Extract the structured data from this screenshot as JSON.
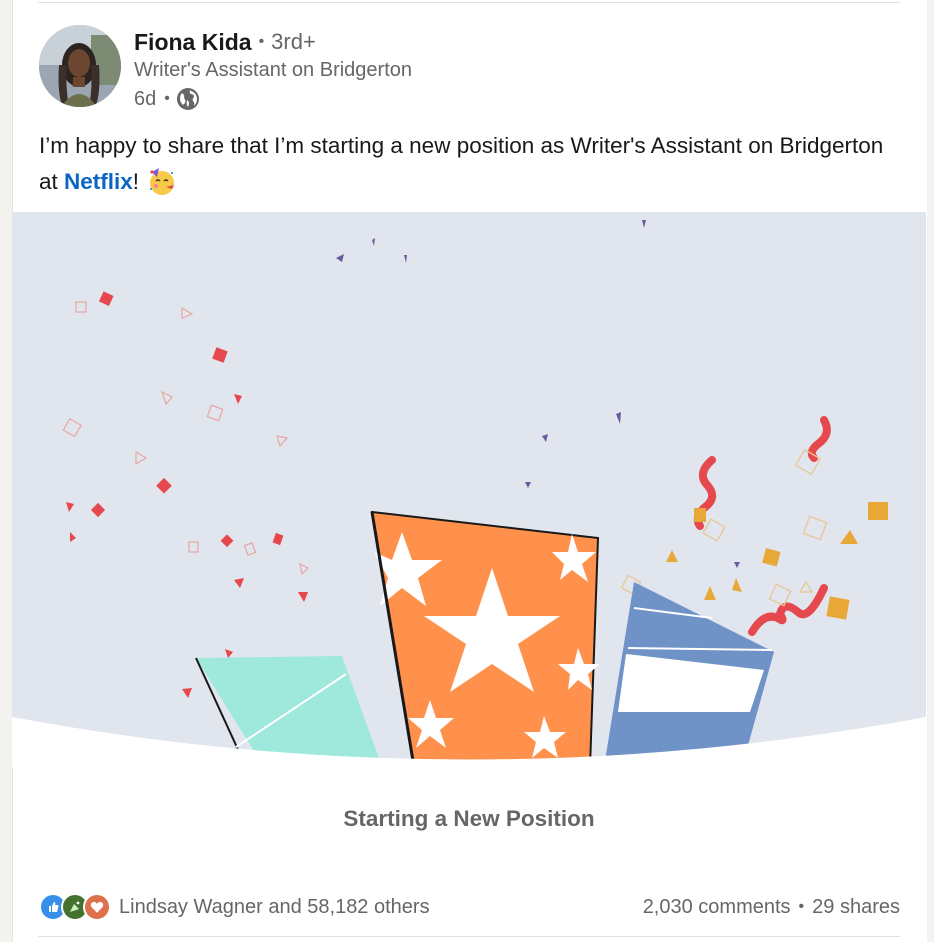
{
  "post": {
    "author": {
      "name": "Fiona Kida",
      "degree": "3rd+",
      "headline": "Writer's Assistant on Bridgerton",
      "time_ago": "6d",
      "visibility_icon": "globe-icon"
    },
    "body": {
      "text_before_link": "I’m happy to share that I’m starting a new position as Writer's Assistant on Bridgerton at ",
      "company_link": "Netflix",
      "text_after_link": "!",
      "emoji": "partying-face-emoji"
    },
    "illustration": {
      "caption": "Starting a New Position",
      "background_color": "#e1e6ee"
    },
    "social": {
      "reaction_icons": [
        "like-icon",
        "celebrate-icon",
        "love-icon"
      ],
      "reactors": "Lindsay Wagner and 58,182 others",
      "comments": "2,030 comments",
      "separator": "•",
      "shares": "29 shares"
    }
  },
  "colors": {
    "link": "#0a66c2",
    "secondary_text": "#666666",
    "primary_text": "#191919",
    "confetti_red": "#e5484d",
    "gift_orange": "#ff914d",
    "gift_teal": "#9ee8dc",
    "gift_blue": "#6f92c7",
    "confetti_gold": "#e8a838"
  }
}
